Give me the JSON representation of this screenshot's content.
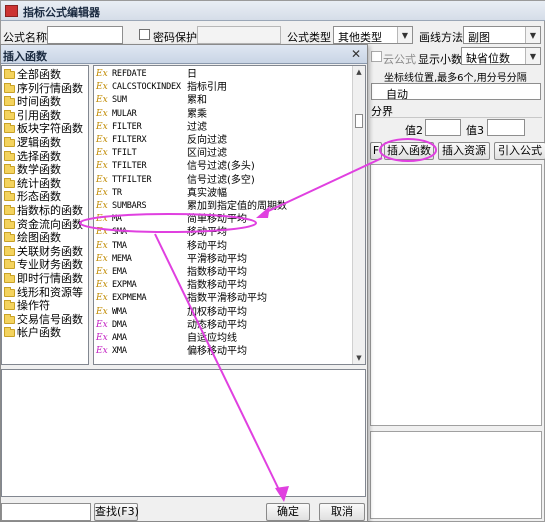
{
  "editor": {
    "title": "指标公式编辑器",
    "formula_name_label": "公式名称",
    "password_label": "密码保护",
    "formula_type_label": "公式类型",
    "formula_type_value": "其他类型",
    "draw_method_label": "画线方法",
    "draw_method_value": "副图",
    "cloud_formula": "云公式",
    "show_decimal_label": "显示小数",
    "show_decimal_value": "缺省位数",
    "coord_hint": "坐标线位置,最多6个,用分号分隔",
    "auto_value": "自动",
    "bounds_label": "分界",
    "value2_label": "值2",
    "value3_label": "值3",
    "partial_button": "F",
    "insert_function_button": "插入函数",
    "insert_resource_button": "插入资源",
    "import_formula_button": "引入公式"
  },
  "dialog": {
    "title": "插入函数",
    "categories": [
      "全部函数",
      "序列行情函数",
      "时间函数",
      "引用函数",
      "板块字符函数",
      "逻辑函数",
      "选择函数",
      "数学函数",
      "统计函数",
      "形态函数",
      "指数标的函数",
      "资金流向函数",
      "绘图函数",
      "关联财务函数",
      "专业财务函数",
      "即时行情函数",
      "线形和资源等",
      "操作符",
      "交易信号函数",
      "帐户函数"
    ],
    "functions": [
      {
        "icon": "Ex",
        "code": "REFDATE",
        "desc": "日"
      },
      {
        "icon": "Ex",
        "code": "CALCSTOCKINDEX",
        "desc": "指标引用"
      },
      {
        "icon": "Ex",
        "code": "SUM",
        "desc": "累和"
      },
      {
        "icon": "Ex",
        "code": "MULAR",
        "desc": "累乘"
      },
      {
        "icon": "Ex",
        "code": "FILTER",
        "desc": "过滤"
      },
      {
        "icon": "Ex",
        "code": "FILTERX",
        "desc": "反向过滤"
      },
      {
        "icon": "Ex",
        "code": "TFILT",
        "desc": "区间过滤"
      },
      {
        "icon": "Ex",
        "code": "TFILTER",
        "desc": "信号过滤(多头)"
      },
      {
        "icon": "Ex",
        "code": "TTFILTER",
        "desc": "信号过滤(多空)"
      },
      {
        "icon": "Ex",
        "code": "TR",
        "desc": "真实波幅"
      },
      {
        "icon": "Ex",
        "code": "SUMBARS",
        "desc": "累加到指定值的周期数"
      },
      {
        "icon": "Ex",
        "code": "MA",
        "desc": "简单移动平均"
      },
      {
        "icon": "Ex",
        "code": "SMA",
        "desc": "移动平均"
      },
      {
        "icon": "Ex",
        "code": "TMA",
        "desc": "移动平均"
      },
      {
        "icon": "Ex",
        "code": "MEMA",
        "desc": "平滑移动平均"
      },
      {
        "icon": "Ex",
        "code": "EMA",
        "desc": "指数移动平均"
      },
      {
        "icon": "Ex",
        "code": "EXPMA",
        "desc": "指数移动平均"
      },
      {
        "icon": "Ex",
        "code": "EXPMEMA",
        "desc": "指数平滑移动平均"
      },
      {
        "icon": "Ex",
        "code": "WMA",
        "desc": "加权移动平均"
      },
      {
        "icon": "Ex",
        "code": "DMA",
        "desc": "动态移动平均"
      },
      {
        "icon": "Ex",
        "code": "AMA",
        "desc": "自适应均线"
      },
      {
        "icon": "Ex",
        "code": "XMA",
        "desc": "偏移移动平均"
      }
    ],
    "find_button": "查找(F3)",
    "ok_button": "确定",
    "cancel_button": "取消"
  },
  "colors": {
    "annotation": "#e040e0"
  }
}
